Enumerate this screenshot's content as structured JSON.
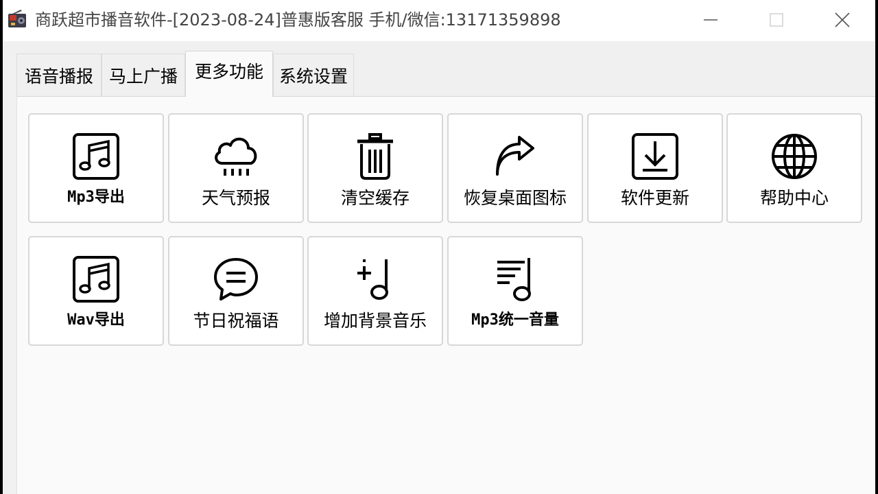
{
  "window": {
    "title": "商跃超市播音软件-[2023-08-24]普惠版客服 手机/微信:13171359898"
  },
  "tabs": [
    {
      "label": "语音播报",
      "active": false
    },
    {
      "label": "马上广播",
      "active": false
    },
    {
      "label": "更多功能",
      "active": true
    },
    {
      "label": "系统设置",
      "active": false
    }
  ],
  "buttons": [
    {
      "label": "Mp3导出",
      "icon": "music-note-icon"
    },
    {
      "label": "天气预报",
      "icon": "rain-cloud-icon"
    },
    {
      "label": "清空缓存",
      "icon": "trash-icon"
    },
    {
      "label": "恢复桌面图标",
      "icon": "share-arrow-icon"
    },
    {
      "label": "软件更新",
      "icon": "download-icon"
    },
    {
      "label": "帮助中心",
      "icon": "globe-icon"
    },
    {
      "label": "Wav导出",
      "icon": "music-note-icon"
    },
    {
      "label": "节日祝福语",
      "icon": "chat-bubble-icon"
    },
    {
      "label": "增加背景音乐",
      "icon": "add-music-icon"
    },
    {
      "label": "Mp3统一音量",
      "icon": "music-list-icon"
    }
  ]
}
